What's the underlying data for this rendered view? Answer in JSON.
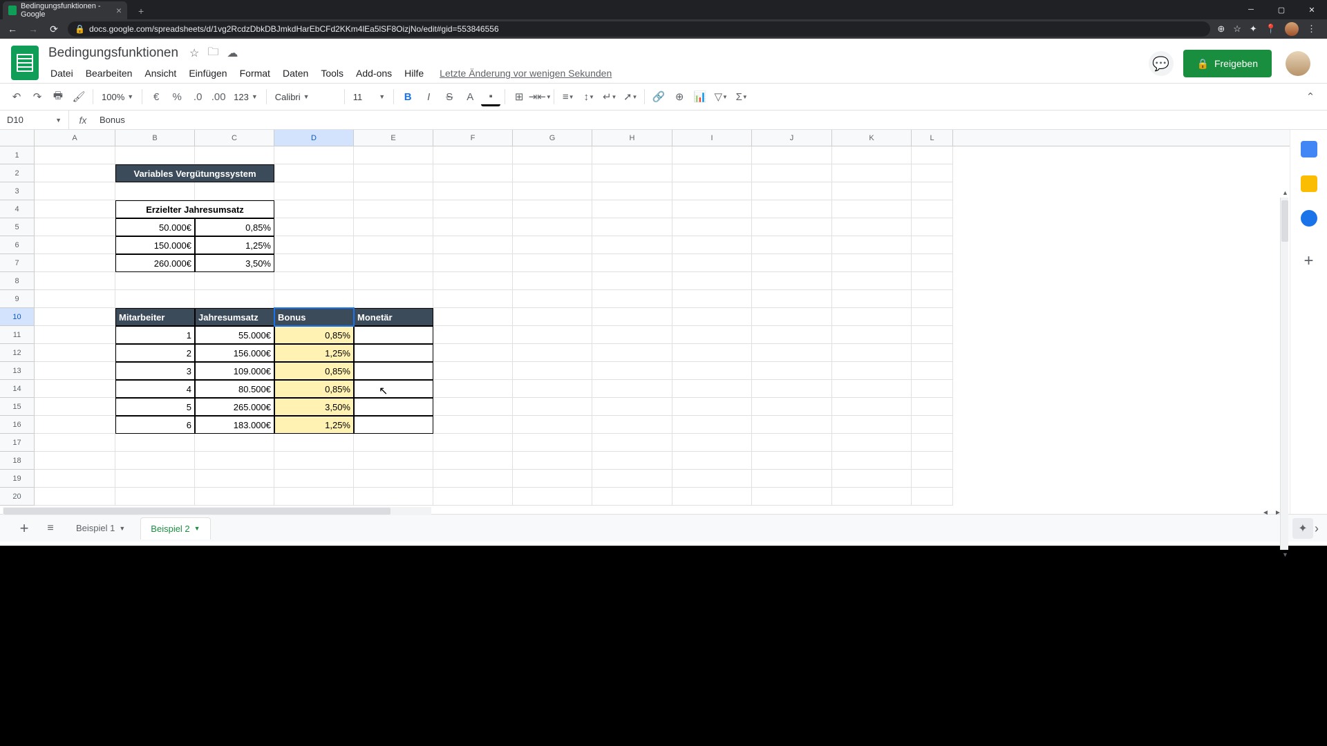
{
  "browser": {
    "tab_title": "Bedingungsfunktionen - Google",
    "url": "docs.google.com/spreadsheets/d/1vg2RcdzDbkDBJmkdHarEbCFd2KKm4lEa5lSF8OizjNo/edit#gid=553846556"
  },
  "header": {
    "doc_title": "Bedingungsfunktionen",
    "menus": [
      "Datei",
      "Bearbeiten",
      "Ansicht",
      "Einfügen",
      "Format",
      "Daten",
      "Tools",
      "Add-ons",
      "Hilfe"
    ],
    "last_edit": "Letzte Änderung vor wenigen Sekunden",
    "share_label": "Freigeben"
  },
  "toolbar": {
    "zoom": "100%",
    "font": "Calibri",
    "font_size": "11",
    "number_format": "123"
  },
  "formula_bar": {
    "cell_ref": "D10",
    "formula": "Bonus"
  },
  "columns": [
    "A",
    "B",
    "C",
    "D",
    "E",
    "F",
    "G",
    "H",
    "I",
    "J",
    "K",
    "L"
  ],
  "rows_visible": 20,
  "sheet": {
    "title1": "Variables Vergütungssystem",
    "title2": "Erzielter Jahresumsatz",
    "tiers": [
      {
        "amount": "50.000€",
        "rate": "0,85%"
      },
      {
        "amount": "150.000€",
        "rate": "1,25%"
      },
      {
        "amount": "260.000€",
        "rate": "3,50%"
      }
    ],
    "table_headers": {
      "a": "Mitarbeiter",
      "b": "Jahresumsatz",
      "c": "Bonus",
      "d": "Monetär"
    },
    "table_rows": [
      {
        "id": "1",
        "umsatz": "55.000€",
        "bonus": "0,85%",
        "mon": ""
      },
      {
        "id": "2",
        "umsatz": "156.000€",
        "bonus": "1,25%",
        "mon": ""
      },
      {
        "id": "3",
        "umsatz": "109.000€",
        "bonus": "0,85%",
        "mon": ""
      },
      {
        "id": "4",
        "umsatz": "80.500€",
        "bonus": "0,85%",
        "mon": ""
      },
      {
        "id": "5",
        "umsatz": "265.000€",
        "bonus": "3,50%",
        "mon": ""
      },
      {
        "id": "6",
        "umsatz": "183.000€",
        "bonus": "1,25%",
        "mon": ""
      }
    ]
  },
  "tabs": {
    "t1": "Beispiel 1",
    "t2": "Beispiel 2"
  },
  "selected_cell": "D10",
  "selected_col": "D",
  "selected_row": 10
}
